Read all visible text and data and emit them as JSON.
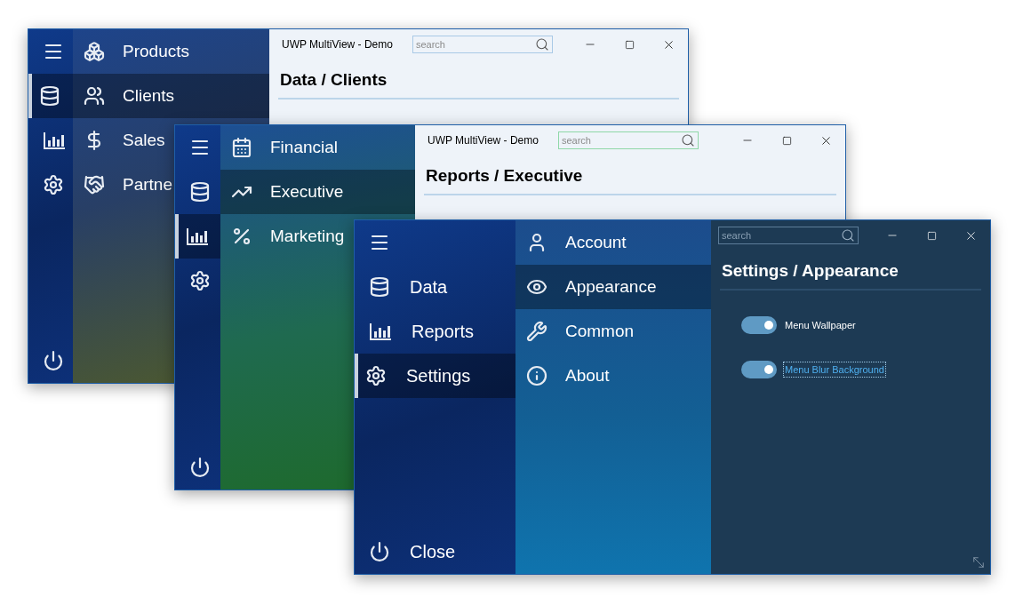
{
  "windows": [
    {
      "title": "UWP MultiView - Demo",
      "kind": "light",
      "search": {
        "placeholder": "search",
        "focused": false
      },
      "heading": "Data / Clients",
      "nav": [
        {
          "kind": "menu",
          "selected": false
        },
        {
          "kind": "data",
          "selected": true
        },
        {
          "kind": "reports",
          "selected": false
        },
        {
          "kind": "settings",
          "selected": false
        },
        {
          "kind": "close",
          "selected": false
        }
      ],
      "submenu": [
        {
          "kind": "products",
          "label": "Products",
          "selected": false
        },
        {
          "kind": "clients",
          "label": "Clients",
          "selected": true
        },
        {
          "kind": "sales",
          "label": "Sales",
          "selected": false
        },
        {
          "kind": "partners",
          "label": "Partne",
          "selected": false
        }
      ]
    },
    {
      "title": "UWP MultiView - Demo",
      "kind": "light",
      "search": {
        "placeholder": "search",
        "focused": true
      },
      "heading": "Reports / Executive",
      "nav": [
        {
          "kind": "menu",
          "selected": false
        },
        {
          "kind": "data",
          "selected": false
        },
        {
          "kind": "reports",
          "selected": true
        },
        {
          "kind": "settings",
          "selected": false
        },
        {
          "kind": "close",
          "selected": false
        }
      ],
      "submenu": [
        {
          "kind": "financial",
          "label": "Financial",
          "selected": false
        },
        {
          "kind": "executive",
          "label": "Executive",
          "selected": true
        },
        {
          "kind": "marketing",
          "label": "Marketing",
          "selected": false
        }
      ]
    },
    {
      "kind": "dark",
      "search": {
        "placeholder": "search",
        "focused": false
      },
      "heading": "Settings / Appearance",
      "nav": [
        {
          "kind": "menu",
          "selected": false
        },
        {
          "kind": "data",
          "label": "Data",
          "selected": false
        },
        {
          "kind": "reports",
          "label": "Reports",
          "selected": false
        },
        {
          "kind": "settings",
          "label": "Settings",
          "selected": true
        },
        {
          "kind": "close",
          "label": "Close",
          "selected": false
        }
      ],
      "submenu": [
        {
          "kind": "account",
          "label": "Account",
          "selected": false
        },
        {
          "kind": "appearance",
          "label": "Appearance",
          "selected": true
        },
        {
          "kind": "common",
          "label": "Common",
          "selected": false
        },
        {
          "kind": "about",
          "label": "About",
          "selected": false
        }
      ],
      "toggles": [
        {
          "label": "Menu Wallpaper",
          "on": true,
          "focused": false
        },
        {
          "label": "Menu Blur Background",
          "on": true,
          "focused": true
        }
      ]
    }
  ]
}
